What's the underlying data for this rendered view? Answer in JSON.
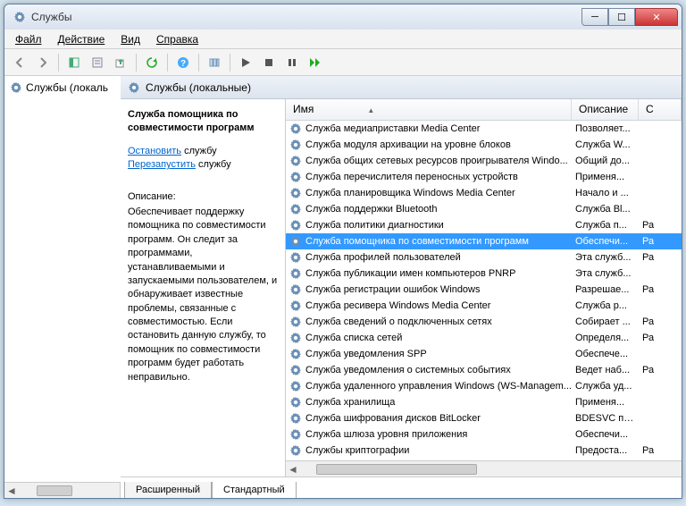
{
  "window": {
    "title": "Службы"
  },
  "menu": {
    "file": "Файл",
    "action": "Действие",
    "view": "Вид",
    "help": "Справка"
  },
  "tree": {
    "root": "Службы (локаль"
  },
  "pane": {
    "header": "Службы (локальные)"
  },
  "detail": {
    "title": "Служба помощника по совместимости программ",
    "stop_link": "Остановить",
    "stop_rest": " службу",
    "restart_link": "Перезапустить",
    "restart_rest": " службу",
    "desc_label": "Описание:",
    "description": "Обеспечивает поддержку помощника по совместимости программ. Он следит за программами, устанавливаемыми и запускаемыми пользователем, и обнаруживает известные проблемы, связанные с совместимостью. Если остановить данную службу, то помощник по совместимости программ будет работать неправильно."
  },
  "columns": {
    "name": "Имя",
    "desc": "Описание",
    "status": "С"
  },
  "services": [
    {
      "name": "Служба медиаприставки Media Center",
      "desc": "Позволяет...",
      "status": ""
    },
    {
      "name": "Служба модуля архивации на уровне блоков",
      "desc": "Служба W...",
      "status": ""
    },
    {
      "name": "Служба общих сетевых ресурсов проигрывателя Windo...",
      "desc": "Общий до...",
      "status": ""
    },
    {
      "name": "Служба перечислителя переносных устройств",
      "desc": "Применя...",
      "status": ""
    },
    {
      "name": "Служба планировщика Windows Media Center",
      "desc": "Начало и ...",
      "status": ""
    },
    {
      "name": "Служба поддержки Bluetooth",
      "desc": "Служба Bl...",
      "status": ""
    },
    {
      "name": "Служба политики диагностики",
      "desc": "Служба п...",
      "status": "Ра"
    },
    {
      "name": "Служба помощника по совместимости программ",
      "desc": "Обеспечи...",
      "status": "Ра",
      "selected": true
    },
    {
      "name": "Служба профилей пользователей",
      "desc": "Эта служб...",
      "status": "Ра"
    },
    {
      "name": "Служба публикации имен компьютеров PNRP",
      "desc": "Эта служб...",
      "status": ""
    },
    {
      "name": "Служба регистрации ошибок Windows",
      "desc": "Разрешае...",
      "status": "Ра"
    },
    {
      "name": "Служба ресивера Windows Media Center",
      "desc": "Служба р...",
      "status": ""
    },
    {
      "name": "Служба сведений о подключенных сетях",
      "desc": "Собирает ...",
      "status": "Ра"
    },
    {
      "name": "Служба списка сетей",
      "desc": "Определя...",
      "status": "Ра"
    },
    {
      "name": "Служба уведомления SPP",
      "desc": "Обеспече...",
      "status": ""
    },
    {
      "name": "Служба уведомления о системных событиях",
      "desc": "Ведет наб...",
      "status": "Ра"
    },
    {
      "name": "Служба удаленного управления Windows (WS-Managem...",
      "desc": "Служба уд...",
      "status": ""
    },
    {
      "name": "Служба хранилища",
      "desc": "Применя...",
      "status": ""
    },
    {
      "name": "Служба шифрования дисков BitLocker",
      "desc": "BDESVC пр...",
      "status": ""
    },
    {
      "name": "Служба шлюза уровня приложения",
      "desc": "Обеспечи...",
      "status": ""
    },
    {
      "name": "Службы криптографии",
      "desc": "Предоста...",
      "status": "Ра"
    }
  ],
  "tabs": {
    "extended": "Расширенный",
    "standard": "Стандартный"
  }
}
